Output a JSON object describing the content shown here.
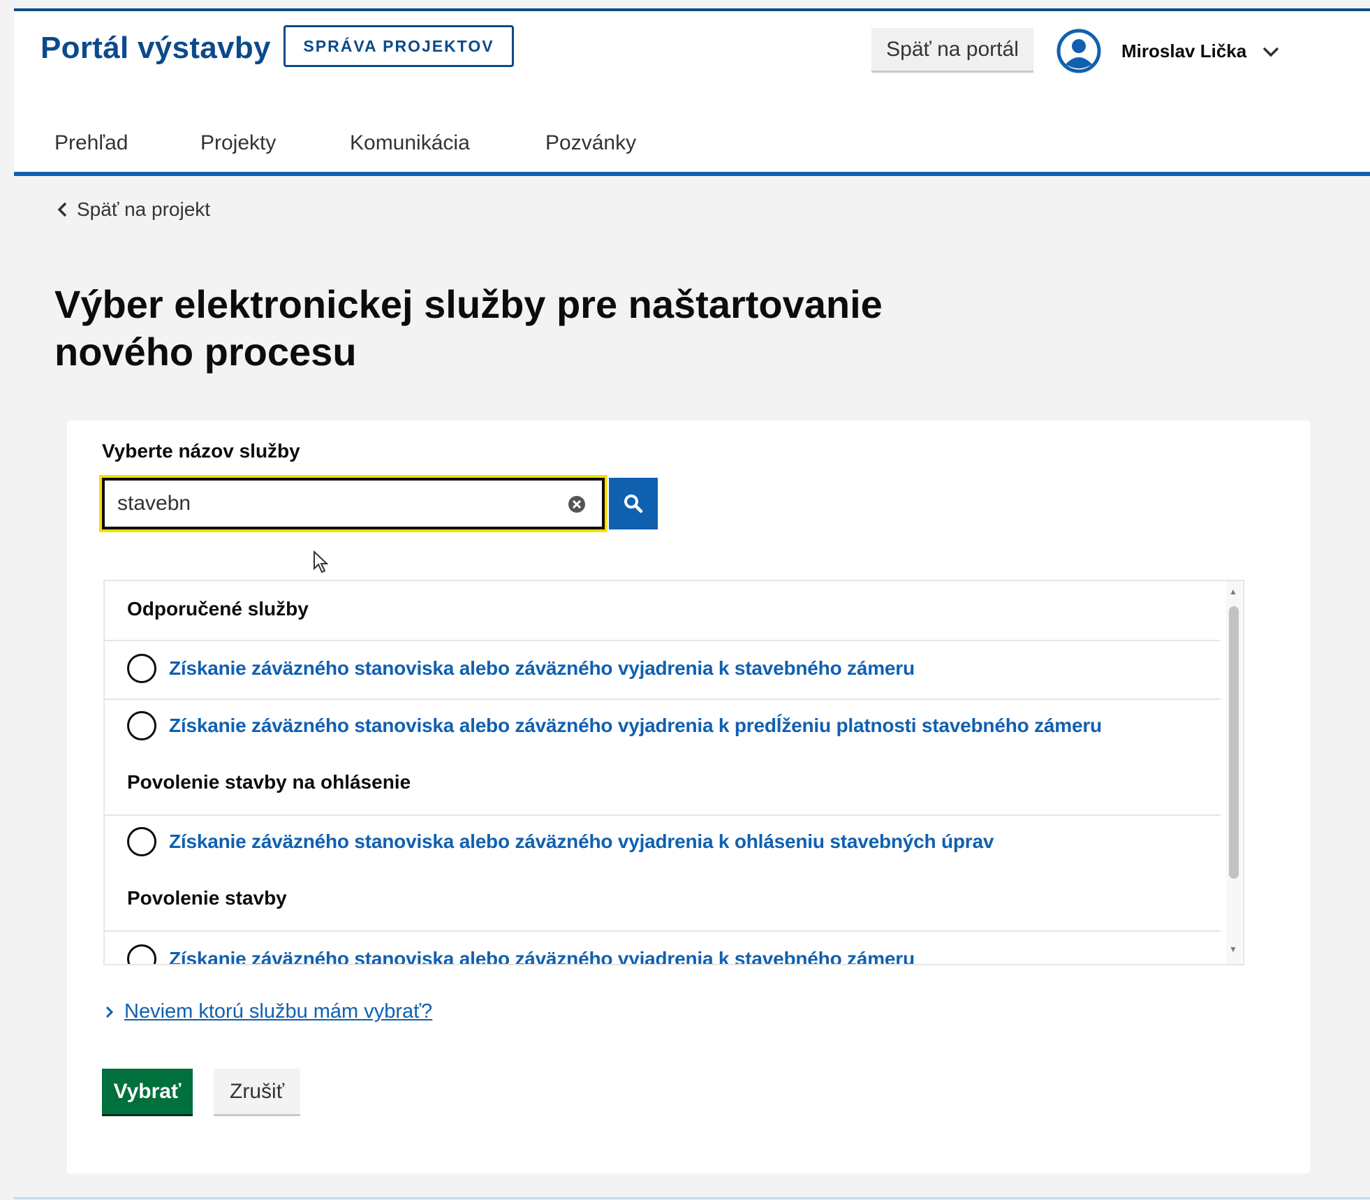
{
  "header": {
    "brand": "Portál výstavby",
    "badge": "SPRÁVA PROJEKTOV",
    "back_to_portal": "Späť na portál",
    "user_name": "Miroslav Lička"
  },
  "nav": {
    "items": [
      {
        "label": "Prehľad"
      },
      {
        "label": "Projekty"
      },
      {
        "label": "Komunikácia"
      },
      {
        "label": "Pozvánky"
      }
    ]
  },
  "breadcrumb": {
    "back_label": "Späť na projekt"
  },
  "page": {
    "title_line1": "Výber elektronickej služby pre naštartovanie",
    "title_line2": "nového procesu"
  },
  "search": {
    "label": "Vyberte názov služby",
    "value": "stavebn"
  },
  "results": {
    "groups": [
      {
        "title": "Odporučené služby",
        "options": [
          {
            "label": "Získanie záväzného stanoviska alebo záväzného vyjadrenia k stavebného zámeru",
            "selected": false
          },
          {
            "label": "Získanie záväzného stanoviska alebo záväzného vyjadrenia k predĺženiu platnosti stavebného zámeru",
            "selected": false
          }
        ]
      },
      {
        "title": "Povolenie stavby na ohlásenie",
        "options": [
          {
            "label": "Získanie záväzného stanoviska alebo záväzného vyjadrenia k ohláseniu stavebných úprav",
            "selected": false
          }
        ]
      },
      {
        "title": "Povolenie stavby",
        "options": [
          {
            "label": "Získanie záväzného stanoviska alebo záväzného vyjadrenia k stavebného zámeru",
            "selected": false
          }
        ]
      }
    ]
  },
  "help": {
    "link_label": "Neviem ktorú službu mám vybrať?"
  },
  "actions": {
    "select_label": "Vybrať",
    "cancel_label": "Zrušiť"
  },
  "colors": {
    "brand_blue": "#0b4a8b",
    "link_blue": "#1060b0",
    "primary_green": "#00703c",
    "focus_yellow": "#ffdd00"
  },
  "icons": [
    "user-avatar-icon",
    "chevron-down-icon",
    "chevron-left-icon",
    "clear-icon",
    "search-icon",
    "cursor-icon",
    "chevron-right-icon"
  ]
}
